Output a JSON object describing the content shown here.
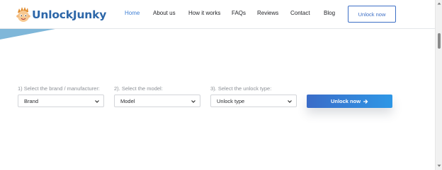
{
  "brand": {
    "name_part1": "Unlock",
    "name_part2": "Junky",
    "icon": "cartoon-face-logo-icon"
  },
  "nav": {
    "items": [
      {
        "label": "Home",
        "active": true
      },
      {
        "label": "About us",
        "active": false
      },
      {
        "label": "How it works",
        "active": false
      },
      {
        "label": "FAQs",
        "active": false
      },
      {
        "label": "Reviews",
        "active": false
      },
      {
        "label": "Contact",
        "active": false
      },
      {
        "label": "Blog",
        "active": false
      }
    ],
    "cta_label": "Unlock now"
  },
  "form": {
    "brand_label": "1) Select the brand / manufacturer:",
    "brand_value": "Brand",
    "model_label": "2). Select the model:",
    "model_value": "Model",
    "type_label": "3). Select the unlock type:",
    "type_value": "Unlock type",
    "submit_label": "Unlock now",
    "submit_icon": "arrow-right-icon"
  },
  "colors": {
    "accent": "#3d7fd4",
    "button_gradient_start": "#3a6cc8",
    "button_gradient_end": "#2e97e6",
    "stripe": "#7fb7d9"
  }
}
